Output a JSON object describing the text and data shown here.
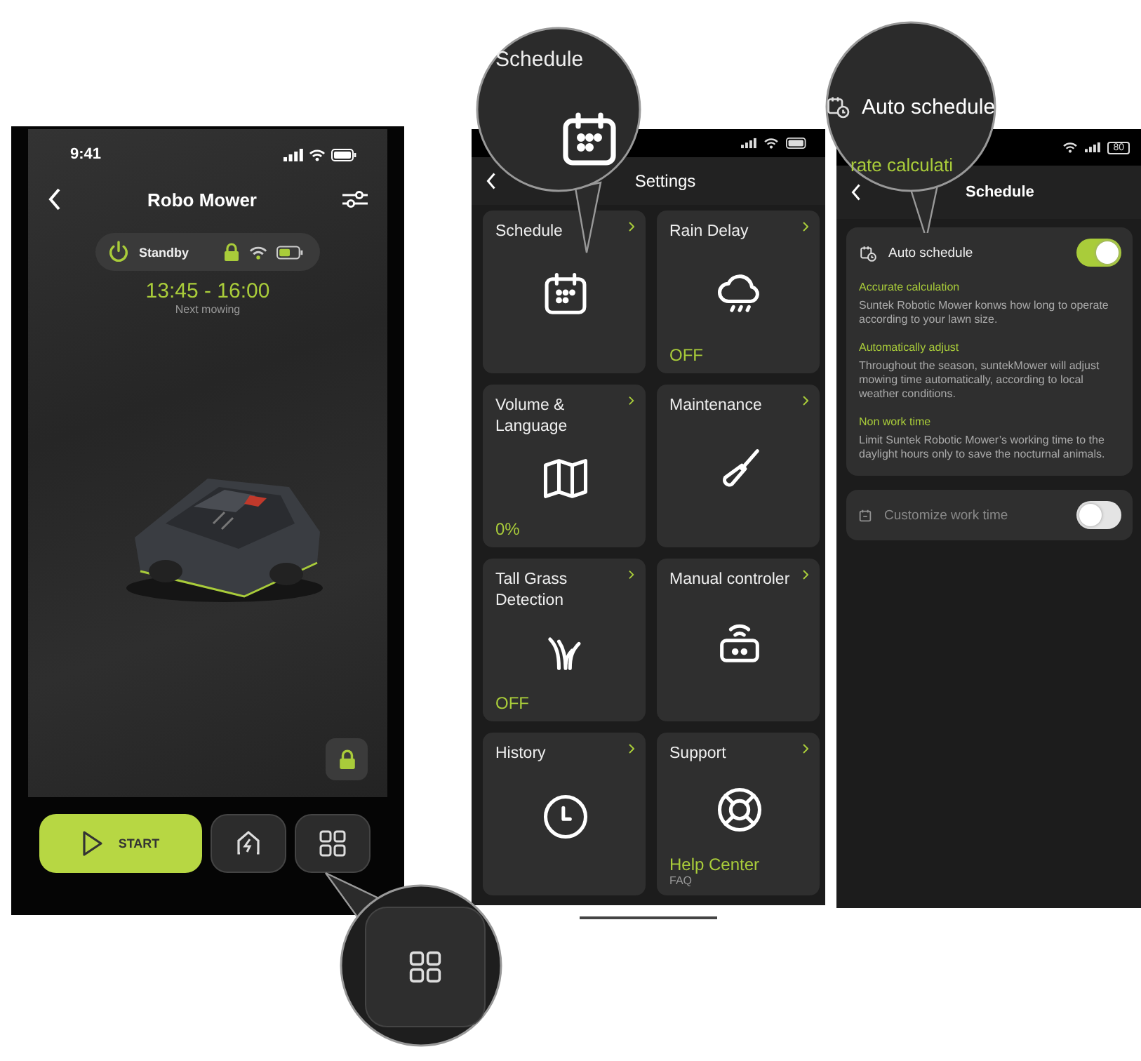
{
  "home": {
    "time": "9:41",
    "title": "Robo Mower",
    "status": "Standby",
    "next_time": "13:45 - 16:00",
    "next_label": "Next mowing",
    "start": "START"
  },
  "settings": {
    "title": "Settings",
    "tiles": [
      {
        "kind": "calendar",
        "title": "Schedule"
      },
      {
        "kind": "rain",
        "title": "Rain Delay",
        "value": "OFF"
      },
      {
        "kind": "map",
        "title": "Volume & Language",
        "value": "0%"
      },
      {
        "kind": "tool",
        "title": "Maintenance"
      },
      {
        "kind": "grass",
        "title": "Tall Grass Detection",
        "value": "OFF"
      },
      {
        "kind": "remote",
        "title": "Manual controler"
      },
      {
        "kind": "clock",
        "title": "History"
      },
      {
        "kind": "lifebuoy",
        "title": "Support",
        "value": "Help Center",
        "note": "FAQ"
      }
    ]
  },
  "schedule": {
    "battery": "80",
    "title": "Schedule",
    "auto": {
      "label": "Auto schedule",
      "on": true
    },
    "sections": [
      {
        "heading": "Accurate calculation",
        "text": "Suntek Robotic Mower konws how long to operate according to your lawn size."
      },
      {
        "heading": "Automatically adjust",
        "text": "Throughout the season, suntekMower will adjust mowing time automatically, according to local weather conditions."
      },
      {
        "heading": "Non work time",
        "text": "Limit Suntek Robotic Mower’s working time to the daylight hours only to save the nocturnal animals."
      }
    ],
    "custom": {
      "label": "Customize work time",
      "on": false,
      "disabled": true
    }
  },
  "callouts": [
    {
      "kind": "tile",
      "label": "Schedule"
    },
    {
      "kind": "toggle",
      "label": "Auto schedule",
      "fragment": "rate calculati"
    },
    {
      "kind": "menu"
    }
  ]
}
